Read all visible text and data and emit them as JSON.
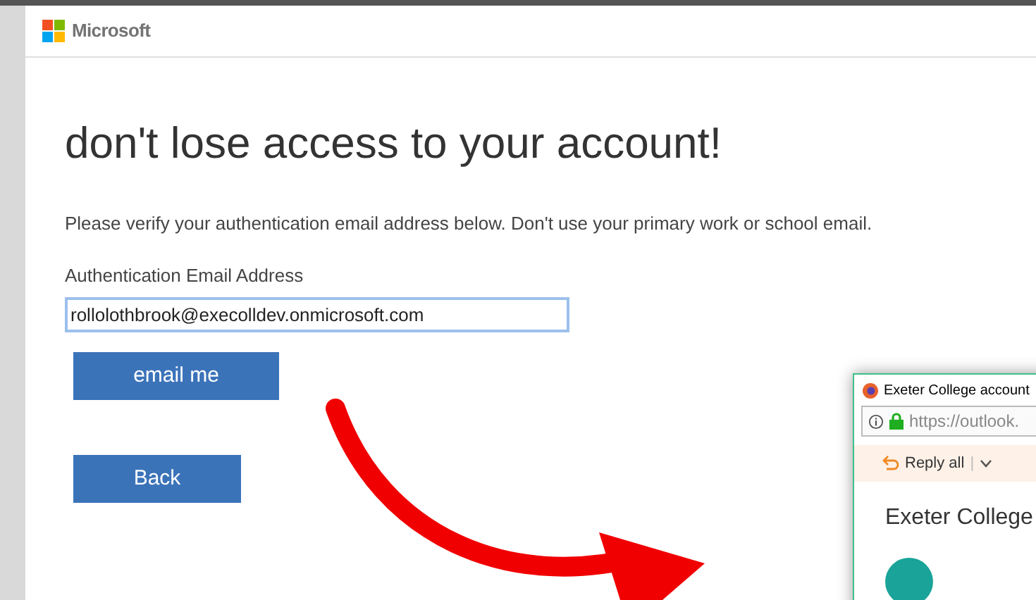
{
  "header": {
    "logo_text": "Microsoft"
  },
  "heading": "don't lose access to your account!",
  "instructions": "Please verify your authentication email address below. Don't use your primary work or school email.",
  "email_field": {
    "label": "Authentication Email Address",
    "value": "rollolothbrook@execolldev.onmicrosoft.com"
  },
  "buttons": [
    {
      "label": "email me"
    },
    {
      "label": "Back"
    }
  ],
  "overlay_window": {
    "title": "Exeter College account",
    "url": "https://outlook.",
    "toolbar": {
      "reply_label": "Reply all",
      "separator": "|"
    },
    "subject": "Exeter College"
  }
}
